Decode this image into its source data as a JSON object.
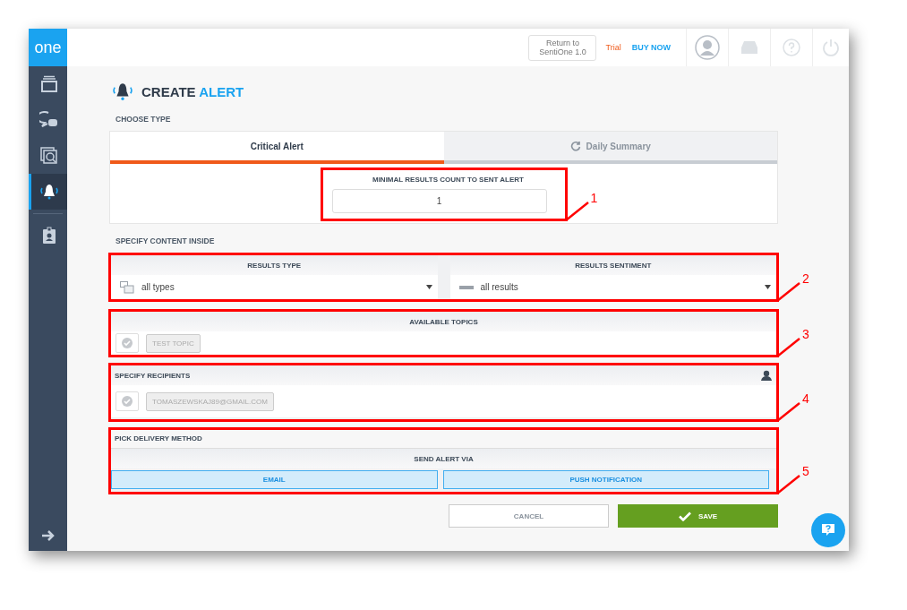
{
  "sidebar": {
    "logo": "one",
    "items": [
      {
        "kind": "stack",
        "selected": false
      },
      {
        "kind": "chat",
        "selected": false
      },
      {
        "kind": "search",
        "selected": false
      },
      {
        "kind": "alert",
        "selected": true
      },
      {
        "kind": "badge",
        "selected": false
      }
    ]
  },
  "topbar": {
    "return_button": "Return to SentiOne 1.0",
    "trial": "Trial",
    "buy_now": "BUY NOW"
  },
  "page": {
    "title_main": "CREATE",
    "title_accent": "ALERT"
  },
  "choose_type": {
    "label": "CHOOSE TYPE",
    "tabs": [
      {
        "kind": "critical",
        "label": "Critical Alert",
        "selected": true
      },
      {
        "kind": "daily",
        "label": "Daily Summary",
        "selected": false
      }
    ],
    "min_count": {
      "label": "MINIMAL RESULTS COUNT TO SENT ALERT",
      "value": "1",
      "callout": "1"
    }
  },
  "content": {
    "label": "SPECIFY CONTENT INSIDE",
    "callout": "2",
    "selects": [
      {
        "kind": "type",
        "label": "RESULTS TYPE",
        "value": "all types"
      },
      {
        "kind": "sentiment",
        "label": "RESULTS SENTIMENT",
        "value": "all results"
      }
    ]
  },
  "topics": {
    "label": "AVAILABLE TOPICS",
    "callout": "3",
    "items": [
      {
        "label": "TEST TOPIC",
        "checked": false
      }
    ]
  },
  "recipients": {
    "label": "SPECIFY RECIPIENTS",
    "callout": "4",
    "items": [
      {
        "label": "TOMASZEWSKAJ89@GMAIL.COM",
        "checked": false
      }
    ]
  },
  "delivery": {
    "label": "PICK DELIVERY METHOD",
    "sub_label": "SEND ALERT VIA",
    "callout": "5",
    "options": [
      {
        "label": "EMAIL",
        "selected": true
      },
      {
        "label": "PUSH NOTIFICATION",
        "selected": true
      }
    ]
  },
  "actions": {
    "cancel": "CANCEL",
    "save": "SAVE"
  }
}
